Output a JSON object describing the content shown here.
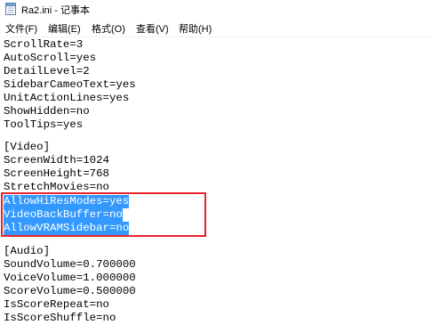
{
  "window": {
    "title": "Ra2.ini - 记事本",
    "icon": "notepad-icon"
  },
  "menu": {
    "file": "文件(F)",
    "edit": "编辑(E)",
    "format": "格式(O)",
    "view": "查看(V)",
    "help": "帮助(H)"
  },
  "editor": {
    "lines": [
      "ScrollRate=3",
      "AutoScroll=yes",
      "DetailLevel=2",
      "SidebarCameoText=yes",
      "UnitActionLines=yes",
      "ShowHidden=no",
      "ToolTips=yes",
      "",
      "[Video]",
      "ScreenWidth=1024",
      "ScreenHeight=768",
      "StretchMovies=no",
      "AllowHiResModes=yes",
      "VideoBackBuffer=no",
      "AllowVRAMSidebar=no",
      "",
      "[Audio]",
      "SoundVolume=0.700000",
      "VoiceVolume=1.000000",
      "ScoreVolume=0.500000",
      "IsScoreRepeat=no",
      "IsScoreShuffle=no"
    ]
  },
  "colors": {
    "selection": "#3399ff",
    "annotation_box": "#e8242c"
  }
}
